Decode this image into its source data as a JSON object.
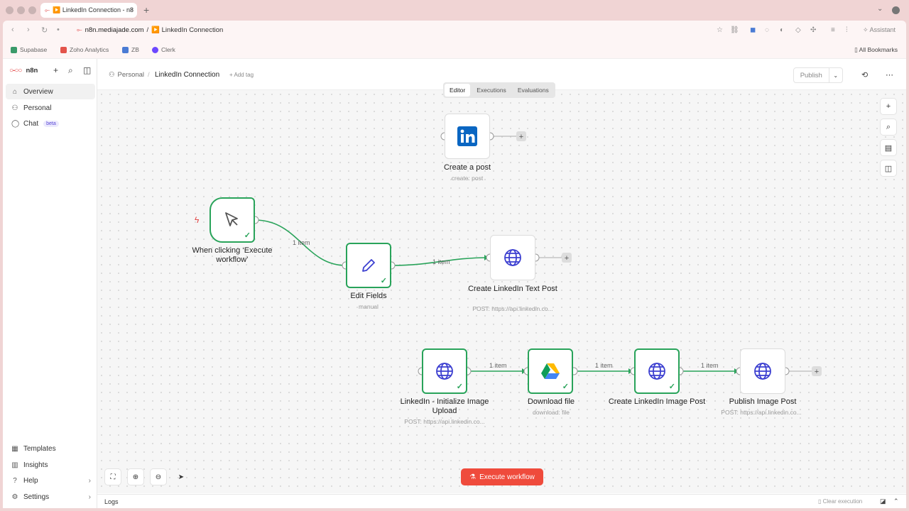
{
  "browser": {
    "tab_title": "▶️ LinkedIn Connection - n8",
    "url_domain": "n8n.mediajade.com",
    "url_sep": "/",
    "url_page": "▶️ LinkedIn Connection",
    "assistant_label": "Assistant",
    "bookmarks": [
      {
        "label": "Supabase",
        "color": "#3a9a6a"
      },
      {
        "label": "Zoho Analytics",
        "color": "#e3544b"
      },
      {
        "label": "ZB",
        "color": "#4a7bd4"
      },
      {
        "label": "Clerk",
        "color": "#6c47ff"
      }
    ],
    "all_bookmarks": "All Bookmarks"
  },
  "sidebar": {
    "brand": "n8n",
    "items": [
      {
        "label": "Overview",
        "icon": "home-icon"
      },
      {
        "label": "Personal",
        "icon": "user-icon"
      },
      {
        "label": "Chat",
        "icon": "chat-icon",
        "badge": "beta"
      }
    ],
    "bottom_items": [
      {
        "label": "Templates",
        "icon": "templates-icon"
      },
      {
        "label": "Insights",
        "icon": "insights-icon"
      },
      {
        "label": "Help",
        "icon": "help-icon"
      },
      {
        "label": "Settings",
        "icon": "settings-icon"
      }
    ]
  },
  "header": {
    "breadcrumb_project": "Personal",
    "breadcrumb_sep": "/",
    "workflow_title": "LinkedIn Connection",
    "add_tag": "+ Add tag",
    "publish_label": "Publish",
    "tabs": [
      "Editor",
      "Executions",
      "Evaluations"
    ],
    "active_tab": "Editor"
  },
  "nodes": {
    "create_post": {
      "title": "Create a post",
      "subtitle": "create: post"
    },
    "trigger": {
      "title": "When clicking ‘Execute workflow’"
    },
    "edit_fields": {
      "title": "Edit Fields",
      "subtitle": "manual"
    },
    "text_post": {
      "title": "Create LinkedIn Text Post",
      "subtitle": "POST: https://api.linkedin.co..."
    },
    "init_upload": {
      "title": "LinkedIn - Initialize Image Upload",
      "subtitle": "POST: https://api.linkedin.co..."
    },
    "download": {
      "title": "Download file",
      "subtitle": "download: file"
    },
    "image_post": {
      "title": "Create LinkedIn Image Post"
    },
    "publish_image": {
      "title": "Publish Image Post",
      "subtitle": "POST: https://api.linkedin.co..."
    }
  },
  "edges": {
    "item_label": "1 item"
  },
  "footer": {
    "execute_label": "Execute workflow",
    "logs_label": "Logs",
    "clear_execution": "Clear execution"
  },
  "colors": {
    "accent": "#ef4b3c",
    "success": "#29a35a",
    "http_icon": "#3c3fd0"
  }
}
